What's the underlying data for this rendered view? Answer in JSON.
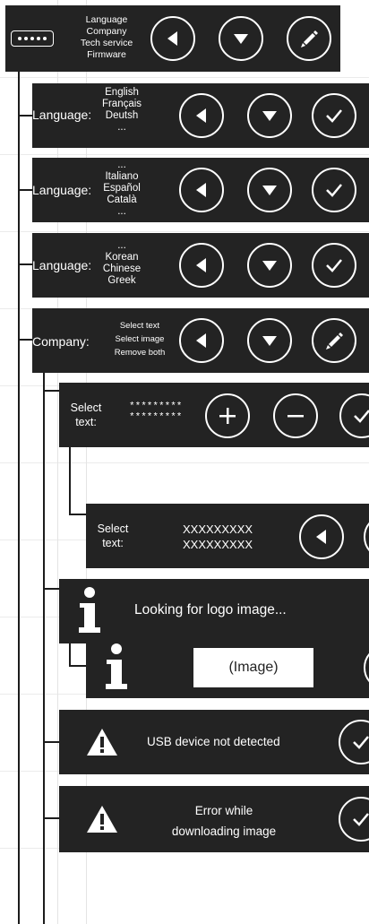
{
  "root": {
    "menu_items": [
      "Language",
      "Company",
      "Tech service",
      "Firmware"
    ]
  },
  "language_1": {
    "label": "Language:",
    "options": [
      "English",
      "Français",
      "Deutsh",
      "..."
    ]
  },
  "language_2": {
    "label": "Language:",
    "options": [
      "...",
      "Italiano",
      "Español",
      "Català",
      "..."
    ]
  },
  "language_3": {
    "label": "Language:",
    "options": [
      "...",
      "Korean",
      "Chinese",
      "Greek"
    ]
  },
  "company": {
    "label": "Company:",
    "options": [
      "Select text",
      "Select image",
      "Remove both"
    ]
  },
  "select_text_1": {
    "label_line1": "Select",
    "label_line2": "text:",
    "value_line1": "*********",
    "value_line2": "*********"
  },
  "select_text_2": {
    "label_line1": "Select",
    "label_line2": "text:",
    "value_line1": "XXXXXXXXX",
    "value_line2": "XXXXXXXXX"
  },
  "logo_search": {
    "message": "Looking for logo image..."
  },
  "logo_image": {
    "placeholder": "(Image)"
  },
  "usb_error": {
    "message": "USB device not detected"
  },
  "download_error": {
    "message_line1": "Error while",
    "message_line2": "downloading image"
  },
  "colors": {
    "panel": "#232323",
    "foreground": "#ffffff",
    "connector": "#1c1c1c",
    "background": "#ffffff"
  },
  "icons": [
    "dots-icon",
    "left-arrow-icon",
    "down-arrow-icon",
    "pencil-icon",
    "check-icon",
    "plus-icon",
    "minus-icon",
    "info-icon",
    "warning-icon"
  ]
}
